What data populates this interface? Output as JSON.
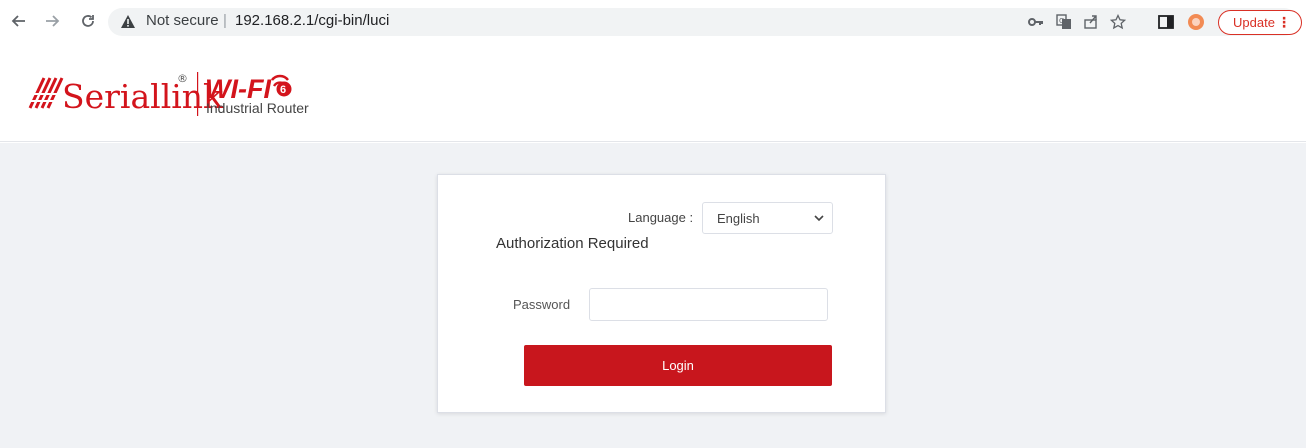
{
  "browser": {
    "back_icon": "arrow-left-icon",
    "forward_icon": "arrow-right-icon",
    "reload_icon": "reload-icon",
    "security_label": "Not secure",
    "separator": "|",
    "url": "192.168.2.1/cgi-bin/luci",
    "update_label": "Update",
    "update_menu": "⋮",
    "colors": {
      "warning": "#d93025"
    }
  },
  "header": {
    "brand_name": "Seriallink",
    "brand_mark": "®",
    "wifi_text": "WI-FI",
    "wifi_generation": "6",
    "product_line": "Industrial Router",
    "colors": {
      "brand_red": "#d3141c",
      "brand_gray": "#444444"
    }
  },
  "login": {
    "language_label": "Language :",
    "language_value": "English",
    "title": "Authorization Required",
    "password_label": "Password",
    "password_value": "",
    "login_label": "Login",
    "colors": {
      "button": "#c8161d"
    }
  }
}
